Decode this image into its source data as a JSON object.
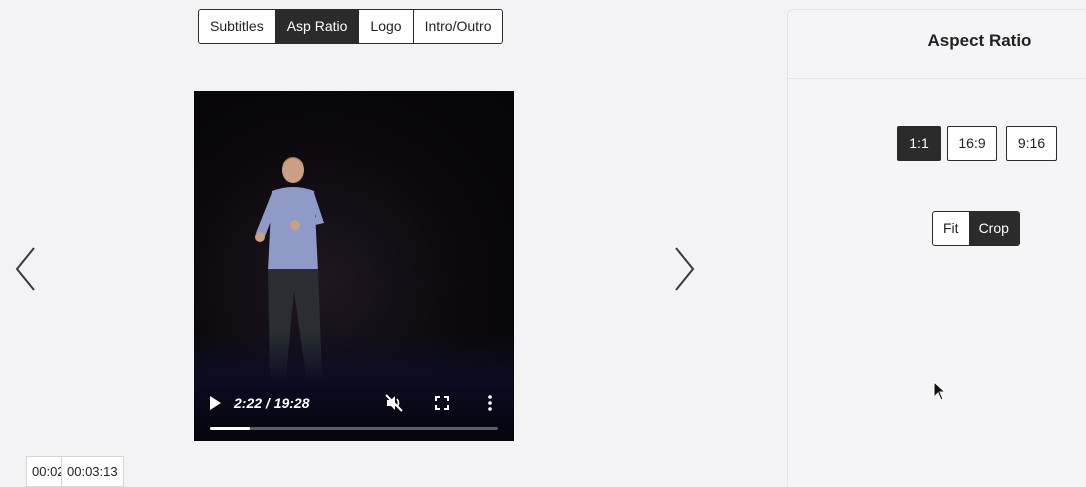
{
  "tabs": [
    {
      "label": "Subtitles",
      "active": false
    },
    {
      "label": "Asp Ratio",
      "active": true
    },
    {
      "label": "Logo",
      "active": false
    },
    {
      "label": "Intro/Outro",
      "active": false
    }
  ],
  "player": {
    "current_time": "2:22",
    "duration": "19:28",
    "time_display": "2:22 / 19:28",
    "progress_fraction": 0.14,
    "muted": true
  },
  "timecodes": {
    "start": "00:02",
    "end": "00:03:13"
  },
  "panel": {
    "title": "Aspect Ratio",
    "ratios": [
      {
        "label": "1:1",
        "active": true
      },
      {
        "label": "16:9",
        "active": false
      },
      {
        "label": "9:16",
        "active": false
      }
    ],
    "fit_modes": [
      {
        "label": "Fit",
        "active": false
      },
      {
        "label": "Crop",
        "active": true
      }
    ]
  },
  "icons": {
    "prev": "chevron-left-icon",
    "next": "chevron-right-icon",
    "play": "play-icon",
    "mute": "volume-muted-icon",
    "fullscreen": "fullscreen-icon",
    "more": "more-vertical-icon"
  },
  "colors": {
    "accent_dark": "#2b2b2b",
    "page_bg": "#f3f3f5",
    "panel_bg": "#f5f5f7"
  }
}
